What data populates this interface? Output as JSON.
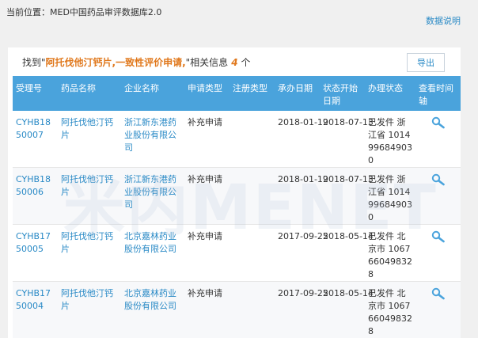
{
  "breadcrumb": "当前位置：MED中国药品审评数据库2.0",
  "help_link": "数据说明",
  "summary": {
    "prefix": "找到\"",
    "query": "阿托伐他汀钙片,一致性评价申请,",
    "suffix": "\"相关信息",
    "count": "4",
    "unit": "个"
  },
  "export_label": "导出",
  "columns": [
    "受理号",
    "药品名称",
    "企业名称",
    "申请类型",
    "注册类型",
    "承办日期",
    "状态开始日期",
    "办理状态",
    "查看时间轴"
  ],
  "rows": [
    {
      "id": "CYHB1850007",
      "drug": "阿托伐他汀钙片",
      "company": "浙江新东港药业股份有限公司",
      "app_type": "补充申请",
      "reg_type": "",
      "date": "2018-01-19",
      "status_date": "2018-07-13",
      "status": "已发件 浙江省 1014996849030"
    },
    {
      "id": "CYHB1850006",
      "drug": "阿托伐他汀钙片",
      "company": "浙江新东港药业股份有限公司",
      "app_type": "补充申请",
      "reg_type": "",
      "date": "2018-01-19",
      "status_date": "2018-07-13",
      "status": "已发件 浙江省 1014996849030"
    },
    {
      "id": "CYHB1750005",
      "drug": "阿托伐他汀钙片",
      "company": "北京嘉林药业股份有限公司",
      "app_type": "补充申请",
      "reg_type": "",
      "date": "2017-09-25",
      "status_date": "2018-05-14",
      "status": "已发件 北京市 1067660498328"
    },
    {
      "id": "CYHB1750004",
      "drug": "阿托伐他汀钙片",
      "company": "北京嘉林药业股份有限公司",
      "app_type": "补充申请",
      "reg_type": "",
      "date": "2017-09-25",
      "status_date": "2018-05-14",
      "status": "已发件 北京市 1067660498328"
    }
  ],
  "watermark": "米内MENET",
  "colors": {
    "header_bg": "#4aa3dc",
    "link": "#2a8ac6",
    "highlight": "#e0781c"
  },
  "icons": {
    "timeline": "magnifier-icon"
  }
}
